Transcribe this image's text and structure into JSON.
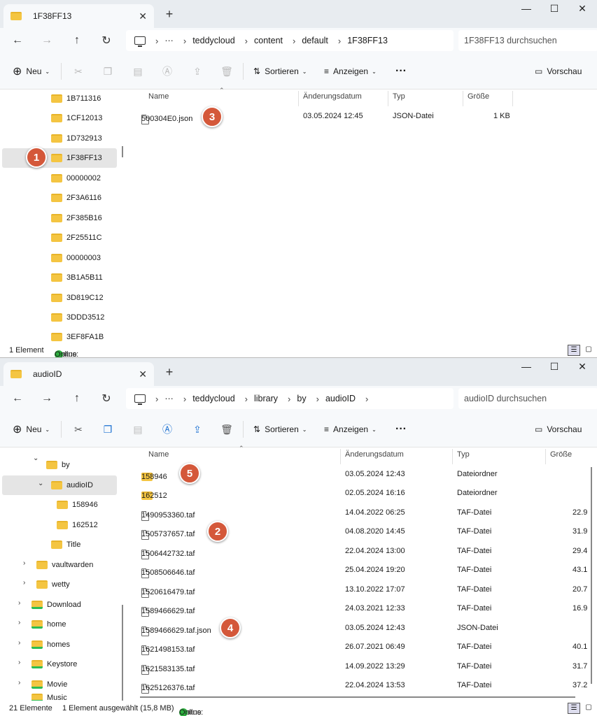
{
  "window1": {
    "tab_title": "1F38FF13",
    "breadcrumb": [
      "teddycloud",
      "content",
      "default",
      "1F38FF13"
    ],
    "ellipsis": "···",
    "search_placeholder": "1F38FF13 durchsuchen",
    "toolbar": {
      "new": "Neu",
      "sort": "Sortieren",
      "view": "Anzeigen",
      "more": "···",
      "preview": "Vorschau"
    },
    "columns": {
      "name": "Name",
      "date": "Änderungsdatum",
      "type": "Typ",
      "size": "Größe"
    },
    "sidebar": [
      "1B711316",
      "1CF12013",
      "1D732913",
      "1F38FF13",
      "00000002",
      "2F3A6116",
      "2F385B16",
      "2F25511C",
      "00000003",
      "3B1A5B11",
      "3D819C12",
      "3DDD3512",
      "3EF8FA1B"
    ],
    "files": [
      {
        "name": "500304E0.json",
        "date": "03.05.2024 12:45",
        "type": "JSON-Datei",
        "size": "1 KB"
      }
    ],
    "status": {
      "count": "1 Element",
      "label": "Status:",
      "online": "Online"
    }
  },
  "window2": {
    "tab_title": "audioID",
    "breadcrumb": [
      "teddycloud",
      "library",
      "by",
      "audioID"
    ],
    "ellipsis": "···",
    "search_placeholder": "audioID durchsuchen",
    "toolbar": {
      "new": "Neu",
      "sort": "Sortieren",
      "view": "Anzeigen",
      "more": "···",
      "preview": "Vorschau"
    },
    "columns": {
      "name": "Name",
      "date": "Änderungsdatum",
      "type": "Typ",
      "size": "Größe"
    },
    "sidebar": [
      "by",
      "audioID",
      "158946",
      "162512",
      "Title",
      "vaultwarden",
      "wetty",
      "Download",
      "home",
      "homes",
      "Keystore",
      "Movie",
      "Music"
    ],
    "files": [
      {
        "name": "158946",
        "date": "03.05.2024 12:43",
        "type": "Dateiordner",
        "size": ""
      },
      {
        "name": "162512",
        "date": "02.05.2024 16:16",
        "type": "Dateiordner",
        "size": ""
      },
      {
        "name": "1490953360.taf",
        "date": "14.04.2022 06:25",
        "type": "TAF-Datei",
        "size": "22.9"
      },
      {
        "name": "1505737657.taf",
        "date": "04.08.2020 14:45",
        "type": "TAF-Datei",
        "size": "31.9"
      },
      {
        "name": "1506442732.taf",
        "date": "22.04.2024 13:00",
        "type": "TAF-Datei",
        "size": "29.4"
      },
      {
        "name": "1508506646.taf",
        "date": "25.04.2024 19:20",
        "type": "TAF-Datei",
        "size": "43.1"
      },
      {
        "name": "1520616479.taf",
        "date": "13.10.2022 17:07",
        "type": "TAF-Datei",
        "size": "20.7"
      },
      {
        "name": "1589466629.taf",
        "date": "24.03.2021 12:33",
        "type": "TAF-Datei",
        "size": "16.9"
      },
      {
        "name": "1589466629.taf.json",
        "date": "03.05.2024 12:43",
        "type": "JSON-Datei",
        "size": ""
      },
      {
        "name": "1621498153.taf",
        "date": "26.07.2021 06:49",
        "type": "TAF-Datei",
        "size": "40.1"
      },
      {
        "name": "1621583135.taf",
        "date": "14.09.2022 13:29",
        "type": "TAF-Datei",
        "size": "31.7"
      },
      {
        "name": "1625126376.taf",
        "date": "22.04.2024 13:53",
        "type": "TAF-Datei",
        "size": "37.2"
      }
    ],
    "status": {
      "count": "21 Elemente",
      "selected": "1 Element ausgewählt (15,8 MB)",
      "label": "Status:",
      "online": "Online"
    }
  },
  "badges": [
    "1",
    "2",
    "3",
    "4",
    "5"
  ],
  "colors": {
    "badge": "#d4583a",
    "folder": "#f4c542",
    "online": "#2dae3e",
    "selection": "#e5e5e5"
  }
}
